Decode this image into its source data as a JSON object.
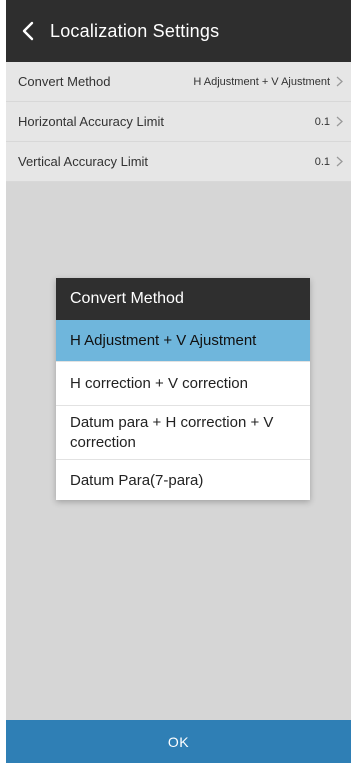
{
  "header": {
    "title": "Localization Settings",
    "back_icon": "chevron-left-icon"
  },
  "settings": [
    {
      "label": "Convert Method",
      "value": "H Adjustment + V Ajustment"
    },
    {
      "label": "Horizontal Accuracy Limit",
      "value": "0.1"
    },
    {
      "label": "Vertical Accuracy Limit",
      "value": "0.1"
    }
  ],
  "dialog": {
    "title": "Convert Method",
    "selected_index": 0,
    "options": [
      "H Adjustment + V Ajustment",
      "H correction + V correction",
      "Datum para + H correction + V correction",
      "Datum Para(7-para)"
    ]
  },
  "footer": {
    "ok_label": "OK"
  },
  "colors": {
    "header_bg": "#2e2e2e",
    "selected_bg": "#6fb6dc",
    "ok_bg": "#2f7fb5",
    "overlay_bg": "#d6d6d6"
  }
}
